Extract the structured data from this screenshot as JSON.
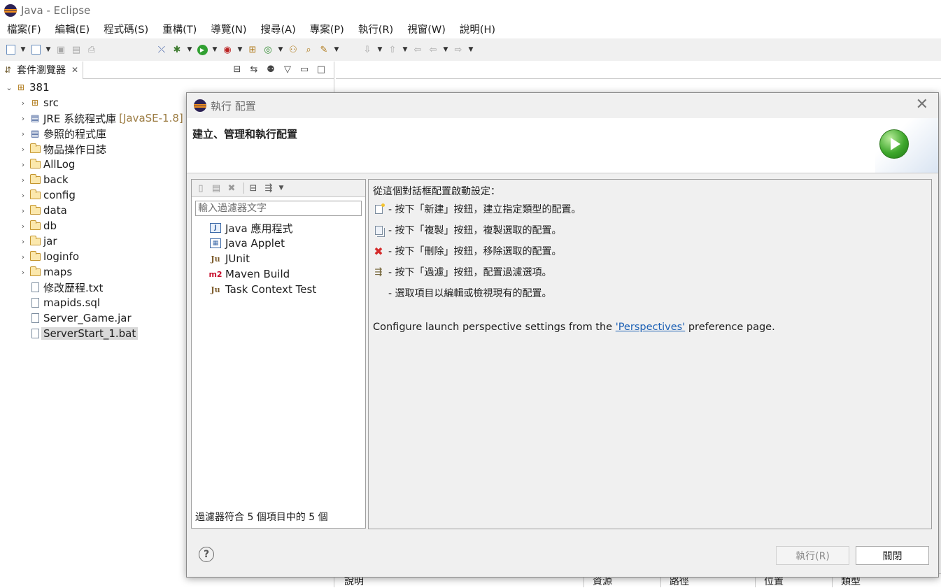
{
  "window": {
    "title": "Java - Eclipse"
  },
  "menu": [
    "檔案(F)",
    "編輯(E)",
    "程式碼(S)",
    "重構(T)",
    "導覽(N)",
    "搜尋(A)",
    "專案(P)",
    "執行(R)",
    "視窗(W)",
    "說明(H)"
  ],
  "toolbar_icons": [
    "new-wizard-icon",
    "open-type-icon",
    "save-icon",
    "save-all-icon",
    "print-icon",
    "skip-breakpoints-icon",
    "debug-icon",
    "run-icon",
    "coverage-icon",
    "new-java-package-icon",
    "new-class-icon",
    "open-type-hierarchy-icon",
    "search-icon",
    "last-edit-icon",
    "back-icon",
    "forward-icon"
  ],
  "explorer": {
    "tab_label": "套件瀏覽器",
    "project": "381",
    "items": [
      {
        "label": "src",
        "icon": "package-folder-icon",
        "expandable": true
      },
      {
        "label": "JRE 系統程式庫",
        "decoration": "[JavaSE-1.8]",
        "icon": "library-icon",
        "expandable": true
      },
      {
        "label": "參照的程式庫",
        "icon": "library-icon",
        "expandable": true
      },
      {
        "label": "物品操作日誌",
        "icon": "folder-icon",
        "expandable": true
      },
      {
        "label": "AllLog",
        "icon": "folder-icon",
        "expandable": true
      },
      {
        "label": "back",
        "icon": "folder-icon",
        "expandable": true
      },
      {
        "label": "config",
        "icon": "folder-icon",
        "expandable": true
      },
      {
        "label": "data",
        "icon": "folder-icon",
        "expandable": true
      },
      {
        "label": "db",
        "icon": "folder-icon",
        "expandable": true
      },
      {
        "label": "jar",
        "icon": "folder-icon",
        "expandable": true
      },
      {
        "label": "loginfo",
        "icon": "folder-icon",
        "expandable": true
      },
      {
        "label": "maps",
        "icon": "folder-icon",
        "expandable": true
      },
      {
        "label": "修改歷程.txt",
        "icon": "file-icon",
        "expandable": false
      },
      {
        "label": "mapids.sql",
        "icon": "file-icon",
        "expandable": false
      },
      {
        "label": "Server_Game.jar",
        "icon": "file-icon",
        "expandable": false
      },
      {
        "label": "ServerStart_1.bat",
        "icon": "file-icon",
        "expandable": false,
        "selected": true
      }
    ]
  },
  "problems_columns": [
    "說明",
    "資源",
    "路徑",
    "位置",
    "類型"
  ],
  "dialog": {
    "title": "執行 配置",
    "heading": "建立、管理和執行配置",
    "filter_placeholder": "輸入過濾器文字",
    "configs": [
      {
        "label": "Java 應用程式",
        "icon": "java-application-icon"
      },
      {
        "label": "Java Applet",
        "icon": "java-applet-icon"
      },
      {
        "label": "JUnit",
        "icon": "junit-icon"
      },
      {
        "label": "Maven Build",
        "icon": "maven-icon"
      },
      {
        "label": "Task Context Test",
        "icon": "task-context-test-icon"
      }
    ],
    "filter_status": "過濾器符合 5 個項目中的 5 個",
    "intro": "從這個對話框配置啟動設定：",
    "instructions": [
      {
        "icon": "new-config-icon",
        "text": "- 按下「新建」按鈕，建立指定類型的配置。"
      },
      {
        "icon": "duplicate-config-icon",
        "text": "- 按下「複製」按鈕，複製選取的配置。"
      },
      {
        "icon": "delete-config-icon",
        "text": "- 按下「刪除」按鈕，移除選取的配置。"
      },
      {
        "icon": "filter-config-icon",
        "text": "- 按下「過濾」按鈕，配置過濾選項。"
      },
      {
        "icon": "",
        "text": "- 選取項目以編輯或檢視現有的配置。"
      }
    ],
    "perspective_prefix": "Configure launch perspective settings from the ",
    "perspective_link": "'Perspectives'",
    "perspective_suffix": " preference page.",
    "run_button": "執行(R)",
    "close_button": "關閉"
  }
}
